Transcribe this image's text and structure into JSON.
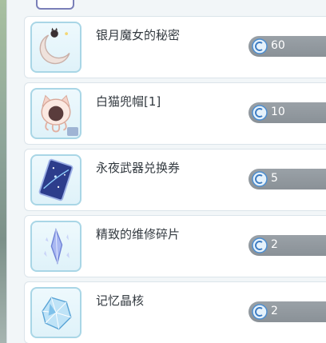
{
  "currency_icon": "crystal-coin-icon",
  "items": [
    {
      "name": "银月魔女的秘密",
      "cost": "60",
      "icon": "crescent-moon-cat-icon"
    },
    {
      "name": "白猫兜帽[1]",
      "cost": "10",
      "icon": "white-cat-hood-icon"
    },
    {
      "name": "永夜武器兑换券",
      "cost": "5",
      "icon": "starry-ticket-icon"
    },
    {
      "name": "精致的维修碎片",
      "cost": "2",
      "icon": "crystal-shard-icon"
    },
    {
      "name": "记忆晶核",
      "cost": "2",
      "icon": "memory-crystal-core-icon"
    }
  ]
}
